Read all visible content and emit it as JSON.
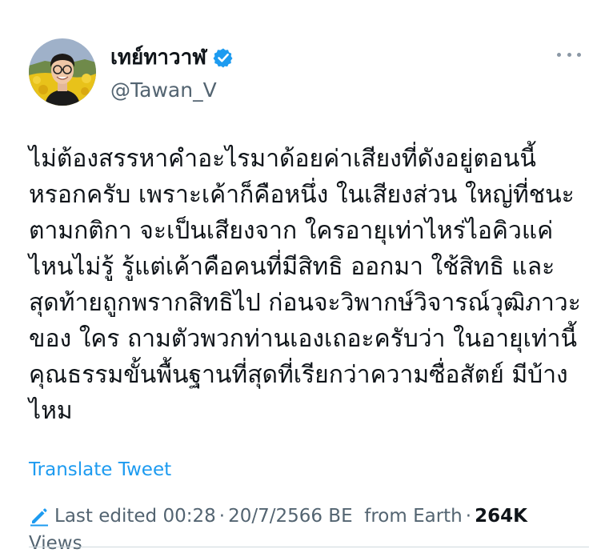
{
  "author": {
    "display_name": "เทย์ทาวาฬ",
    "handle": "@Tawan_V",
    "verified": true,
    "avatar_icon": "user-avatar-photo"
  },
  "tweet": {
    "lines": [
      "ไม่ต้องสรรหาคำอะไรมาด้อยค่าเสียงที่ดังอยู่ตอนนี้",
      "หรอกครับ เพราะเค้าก็คือหนึ่ง ในเสียงส่วน ใหญ่ที่ชนะ",
      "ตามกติกา จะเป็นเสียงจาก ใครอายุเท่าไหร่ไอคิวแค่",
      "ไหนไม่รู้ รู้แต่เค้าคือคนที่มีสิทธิ ออกมา ใช้สิทธิ และ",
      "สุดท้ายถูกพรากสิทธิไป ก่อนจะวิพากษ์วิจารณ์วุฒิภาวะ",
      "ของ ใคร ถามตัวพวกท่านเองเถอะครับว่า ในอายุเท่านี้",
      "คุณธรรมขั้นพื้นฐานที่สุดที่เรียกว่าความซื่อสัตย์ มีบ้าง",
      "ไหม"
    ]
  },
  "actions": {
    "translate_label": "Translate Tweet"
  },
  "meta": {
    "edited_prefix": "Last edited",
    "time": "00:28",
    "date": "20/7/2566 BE",
    "location": "from Earth",
    "views_count": "264K",
    "views_label": "Views",
    "separator": "·"
  },
  "colors": {
    "accent": "#1d9bf0",
    "text_primary": "#0f1419",
    "text_secondary": "#536471"
  }
}
